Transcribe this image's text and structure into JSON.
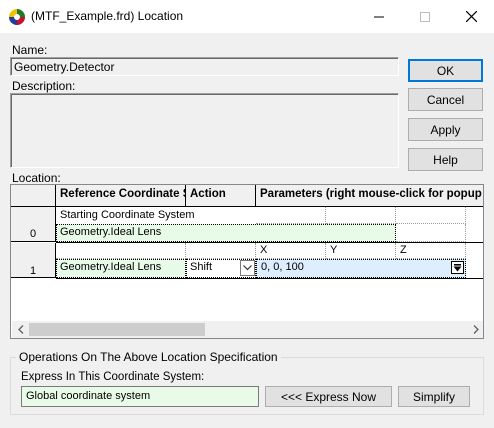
{
  "window": {
    "title": "(MTF_Example.frd) Location",
    "icon": "app-logo-icon"
  },
  "name": {
    "label": "Name:",
    "value": "Geometry.Detector"
  },
  "description": {
    "label": "Description:",
    "value": ""
  },
  "buttons": {
    "ok": "OK",
    "cancel": "Cancel",
    "apply": "Apply",
    "help": "Help"
  },
  "location": {
    "label": "Location:",
    "columns": [
      "Reference Coordinate S",
      "Action",
      "Parameters (right mouse-click for popup"
    ],
    "rows": [
      {
        "number": "0",
        "header": "Starting Coordinate System",
        "coord_system": "Geometry.Ideal Lens"
      },
      {
        "number": "1",
        "sub_headers": [
          "X",
          "Y",
          "Z"
        ],
        "coord_system": "Geometry.Ideal Lens",
        "action": "Shift",
        "parameters": "0,  0,  100"
      }
    ]
  },
  "operations": {
    "group_title": "Operations On The Above Location Specification",
    "express_label": "Express In This Coordinate System:",
    "express_value": "Global coordinate system",
    "express_now_button": "<<< Express Now",
    "simplify_button": "Simplify"
  },
  "colors": {
    "accent": "#0078d7",
    "green_cell": "#e8fbe8",
    "blue_cell": "#ddeeff"
  }
}
